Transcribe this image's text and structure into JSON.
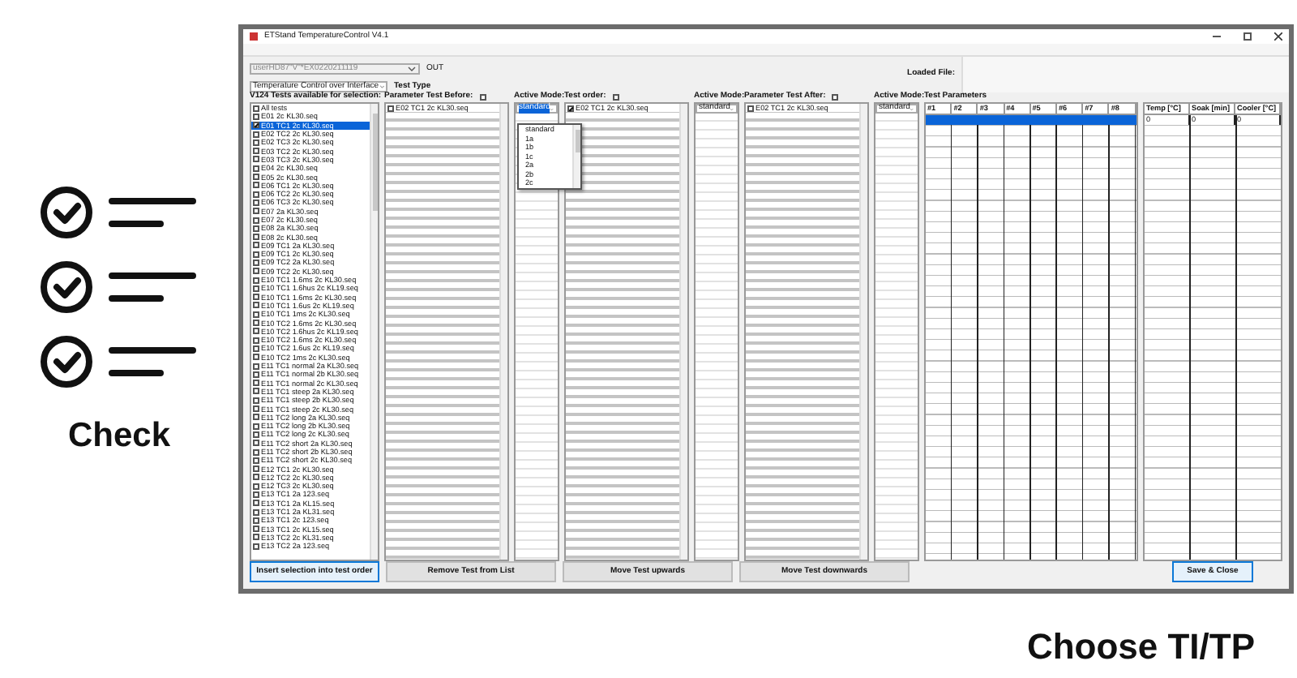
{
  "illustration": {
    "caption": "Check"
  },
  "window": {
    "title": "ETStand TemperatureControl V4.1"
  },
  "top": {
    "profile_combo": "userHD87\"V\"*EX0220211119",
    "profile_label": "OUT",
    "mode_combo": "Temperature Control over Interface",
    "mode_label": "Test Type",
    "loaded_file_label": "Loaded File:"
  },
  "available": {
    "title": "V124 Tests available for selection:",
    "items": [
      {
        "label": "All tests",
        "checked": false,
        "selected": false
      },
      {
        "label": "E01 2c KL30.seq",
        "checked": false,
        "selected": false
      },
      {
        "label": "E01 TC1 2c KL30.seq",
        "checked": true,
        "selected": true
      },
      {
        "label": "E02 TC2 2c KL30.seq",
        "checked": false,
        "selected": false
      },
      {
        "label": "E02 TC3 2c KL30.seq",
        "checked": false,
        "selected": false
      },
      {
        "label": "E03 TC2 2c KL30.seq",
        "checked": false,
        "selected": false
      },
      {
        "label": "E03 TC3 2c KL30.seq",
        "checked": false,
        "selected": false
      },
      {
        "label": "E04 2c KL30.seq",
        "checked": false,
        "selected": false
      },
      {
        "label": "E05 2c KL30.seq",
        "checked": false,
        "selected": false
      },
      {
        "label": "E06 TC1 2c KL30.seq",
        "checked": false,
        "selected": false
      },
      {
        "label": "E06 TC2 2c KL30.seq",
        "checked": false,
        "selected": false
      },
      {
        "label": "E06 TC3 2c KL30.seq",
        "checked": false,
        "selected": false
      },
      {
        "label": "E07 2a KL30.seq",
        "checked": false,
        "selected": false
      },
      {
        "label": "E07 2c KL30.seq",
        "checked": false,
        "selected": false
      },
      {
        "label": "E08 2a KL30.seq",
        "checked": false,
        "selected": false
      },
      {
        "label": "E08 2c KL30.seq",
        "checked": false,
        "selected": false
      },
      {
        "label": "E09 TC1 2a KL30.seq",
        "checked": false,
        "selected": false
      },
      {
        "label": "E09 TC1 2c KL30.seq",
        "checked": false,
        "selected": false
      },
      {
        "label": "E09 TC2 2a KL30.seq",
        "checked": false,
        "selected": false
      },
      {
        "label": "E09 TC2 2c KL30.seq",
        "checked": false,
        "selected": false
      },
      {
        "label": "E10 TC1 1.6ms 2c KL30.seq",
        "checked": false,
        "selected": false
      },
      {
        "label": "E10 TC1 1.6hus 2c KL19.seq",
        "checked": false,
        "selected": false
      },
      {
        "label": "E10 TC1 1.6ms 2c KL30.seq",
        "checked": false,
        "selected": false
      },
      {
        "label": "E10 TC1 1.6us 2c KL19.seq",
        "checked": false,
        "selected": false
      },
      {
        "label": "E10 TC1 1ms 2c KL30.seq",
        "checked": false,
        "selected": false
      },
      {
        "label": "E10 TC2 1.6ms 2c KL30.seq",
        "checked": false,
        "selected": false
      },
      {
        "label": "E10 TC2 1.6hus 2c KL19.seq",
        "checked": false,
        "selected": false
      },
      {
        "label": "E10 TC2 1.6ms 2c KL30.seq",
        "checked": false,
        "selected": false
      },
      {
        "label": "E10 TC2 1.6us 2c KL19.seq",
        "checked": false,
        "selected": false
      },
      {
        "label": "E10 TC2 1ms 2c KL30.seq",
        "checked": false,
        "selected": false
      },
      {
        "label": "E11 TC1 normal 2a KL30.seq",
        "checked": false,
        "selected": false
      },
      {
        "label": "E11 TC1 normal 2b KL30.seq",
        "checked": false,
        "selected": false
      },
      {
        "label": "E11 TC1 normal 2c KL30.seq",
        "checked": false,
        "selected": false
      },
      {
        "label": "E11 TC1 steep 2a KL30.seq",
        "checked": false,
        "selected": false
      },
      {
        "label": "E11 TC1 steep 2b KL30.seq",
        "checked": false,
        "selected": false
      },
      {
        "label": "E11 TC1 steep 2c KL30.seq",
        "checked": false,
        "selected": false
      },
      {
        "label": "E11 TC2 long 2a KL30.seq",
        "checked": false,
        "selected": false
      },
      {
        "label": "E11 TC2 long 2b KL30.seq",
        "checked": false,
        "selected": false
      },
      {
        "label": "E11 TC2 long 2c KL30.seq",
        "checked": false,
        "selected": false
      },
      {
        "label": "E11 TC2 short 2a KL30.seq",
        "checked": false,
        "selected": false
      },
      {
        "label": "E11 TC2 short 2b KL30.seq",
        "checked": false,
        "selected": false
      },
      {
        "label": "E11 TC2 short 2c KL30.seq",
        "checked": false,
        "selected": false
      },
      {
        "label": "E12 TC1 2c KL30.seq",
        "checked": false,
        "selected": false
      },
      {
        "label": "E12 TC2 2c KL30.seq",
        "checked": false,
        "selected": false
      },
      {
        "label": "E12 TC3 2c KL30.seq",
        "checked": false,
        "selected": false
      },
      {
        "label": "E13 TC1 2a 123.seq",
        "checked": false,
        "selected": false
      },
      {
        "label": "E13 TC1 2a KL15.seq",
        "checked": false,
        "selected": false
      },
      {
        "label": "E13 TC1 2a KL31.seq",
        "checked": false,
        "selected": false
      },
      {
        "label": "E13 TC1 2c 123.seq",
        "checked": false,
        "selected": false
      },
      {
        "label": "E13 TC1 2c KL15.seq",
        "checked": false,
        "selected": false
      },
      {
        "label": "E13 TC2 2c KL31.seq",
        "checked": false,
        "selected": false
      },
      {
        "label": "E13 TC2 2a 123.seq",
        "checked": false,
        "selected": false
      }
    ]
  },
  "test_columns": [
    {
      "title": "Parameter Test Before:",
      "header_checked": false,
      "first_row": {
        "label": "E02 TC1 2c KL30.seq",
        "checked": false
      },
      "mode_title": "Active Mode:",
      "mode_value": "standard",
      "mode_open": true
    },
    {
      "title": "Test order:",
      "header_checked": false,
      "first_row": {
        "label": "E02 TC1 2c KL30.seq",
        "checked": true
      },
      "mode_title": "Active Mode:",
      "mode_value": "standard",
      "mode_open": false
    },
    {
      "title": "Parameter Test After:",
      "header_checked": false,
      "first_row": {
        "label": "E02 TC1 2c KL30.seq",
        "checked": false
      },
      "mode_title": "Active Mode:",
      "mode_value": "standard",
      "mode_open": false
    }
  ],
  "mode_dropdown": {
    "options": [
      "standard",
      "1a",
      "1b",
      "1c",
      "2a",
      "2b",
      "2c"
    ]
  },
  "params_table": {
    "title": "Test Parameters",
    "columns": [
      "#1",
      "#2",
      "#3",
      "#4",
      "#5",
      "#6",
      "#7",
      "#8"
    ],
    "first_row_selected": true
  },
  "temp_table": {
    "columns": [
      "Temp [°C]",
      "Soak [min]",
      "Cooler [°C]"
    ],
    "rows": [
      [
        "0",
        "0",
        "0"
      ]
    ]
  },
  "buttons": [
    {
      "label": "Insert selection into test order",
      "kind": "primary"
    },
    {
      "label": "Remove Test from List",
      "kind": "plain"
    },
    {
      "label": "Move Test upwards",
      "kind": "plain"
    },
    {
      "label": "Move Test downwards",
      "kind": "plain"
    },
    {
      "label": "Save & Close",
      "kind": "primary"
    }
  ],
  "footer_caption": "Choose TI/TP"
}
